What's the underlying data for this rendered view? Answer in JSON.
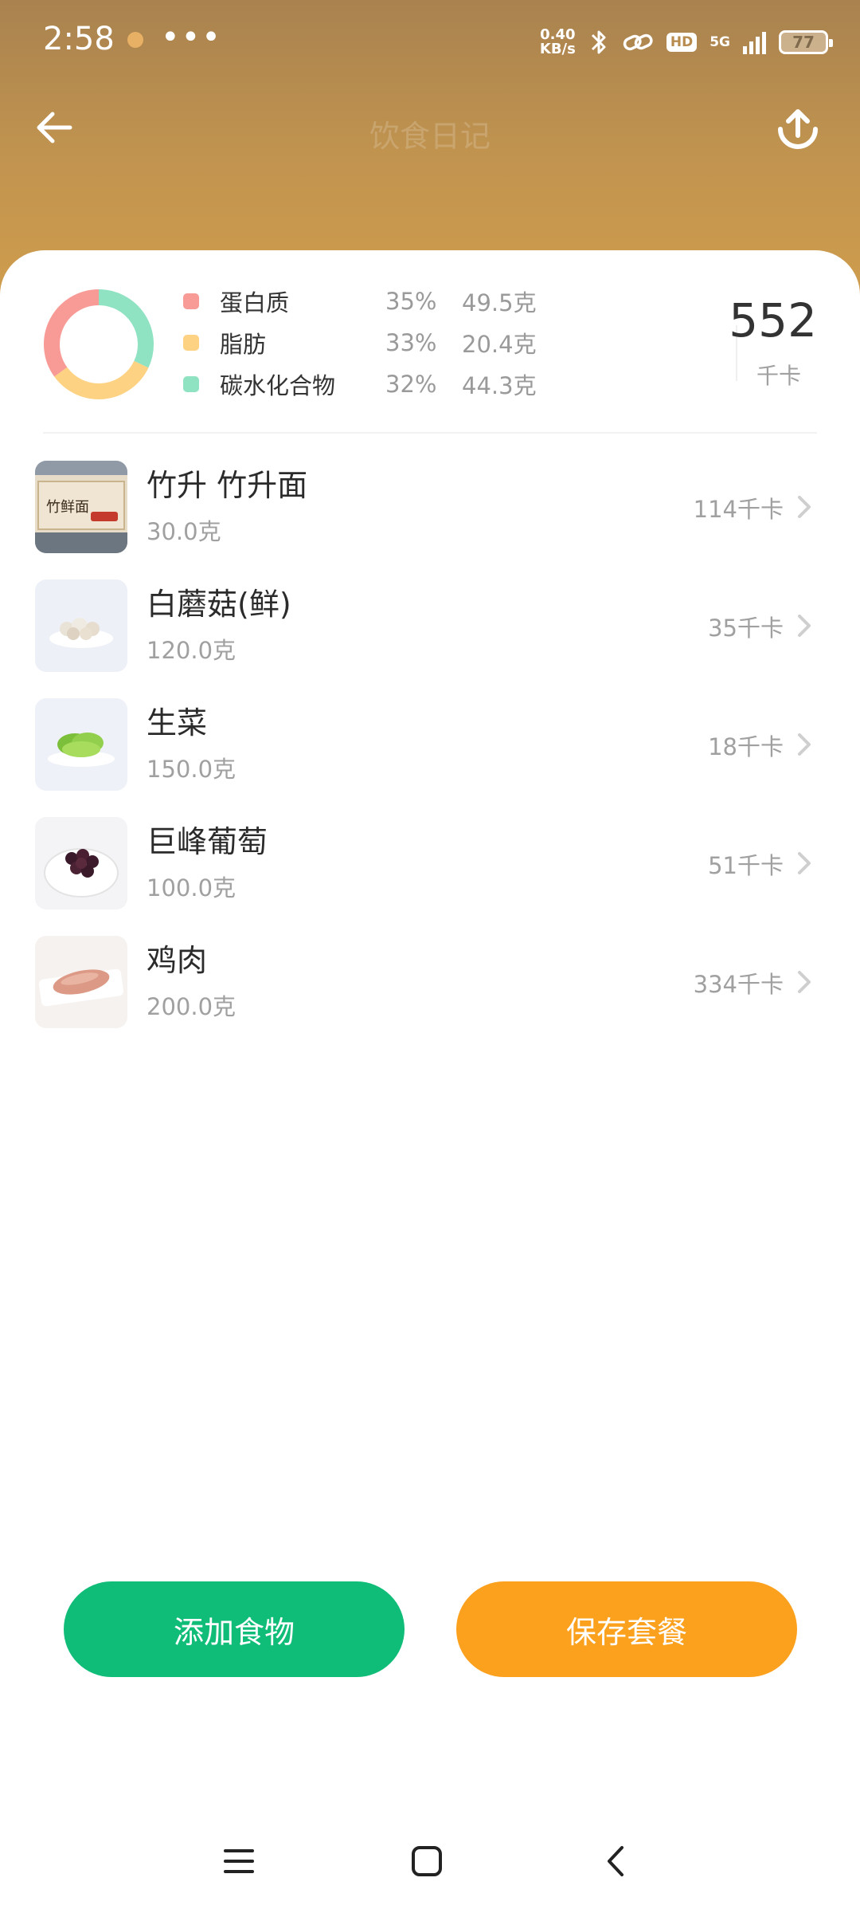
{
  "status_bar": {
    "time": "2:58",
    "more": "•••",
    "speed_value": "0.40",
    "speed_unit": "KB/s",
    "hd": "HD",
    "network": "5G",
    "battery": "77"
  },
  "header": {
    "title": "饮食日记"
  },
  "summary": {
    "macros": [
      {
        "name": "蛋白质",
        "percent": "35%",
        "grams": "49.5克",
        "ratio": 0.35,
        "color": "#f89b96"
      },
      {
        "name": "脂肪",
        "percent": "33%",
        "grams": "20.4克",
        "ratio": 0.33,
        "color": "#fdd283"
      },
      {
        "name": "碳水化合物",
        "percent": "32%",
        "grams": "44.3克",
        "ratio": 0.32,
        "color": "#8fe2c2"
      }
    ],
    "kcal_value": "552",
    "kcal_unit": "千卡"
  },
  "foods": [
    {
      "name": "竹升 竹升面",
      "weight": "30.0克",
      "kcal": "114千卡"
    },
    {
      "name": "白蘑菇(鲜)",
      "weight": "120.0克",
      "kcal": "35千卡"
    },
    {
      "name": "生菜",
      "weight": "150.0克",
      "kcal": "18千卡"
    },
    {
      "name": "巨峰葡萄",
      "weight": "100.0克",
      "kcal": "51千卡"
    },
    {
      "name": "鸡肉",
      "weight": "200.0克",
      "kcal": "334千卡"
    }
  ],
  "actions": {
    "add_food": "添加食物",
    "save_meal": "保存套餐"
  },
  "colors": {
    "header_gradient_top": "#a9824f",
    "header_gradient_bottom": "#d39f4c",
    "add_button": "#10bd78",
    "save_button": "#fba11d"
  }
}
